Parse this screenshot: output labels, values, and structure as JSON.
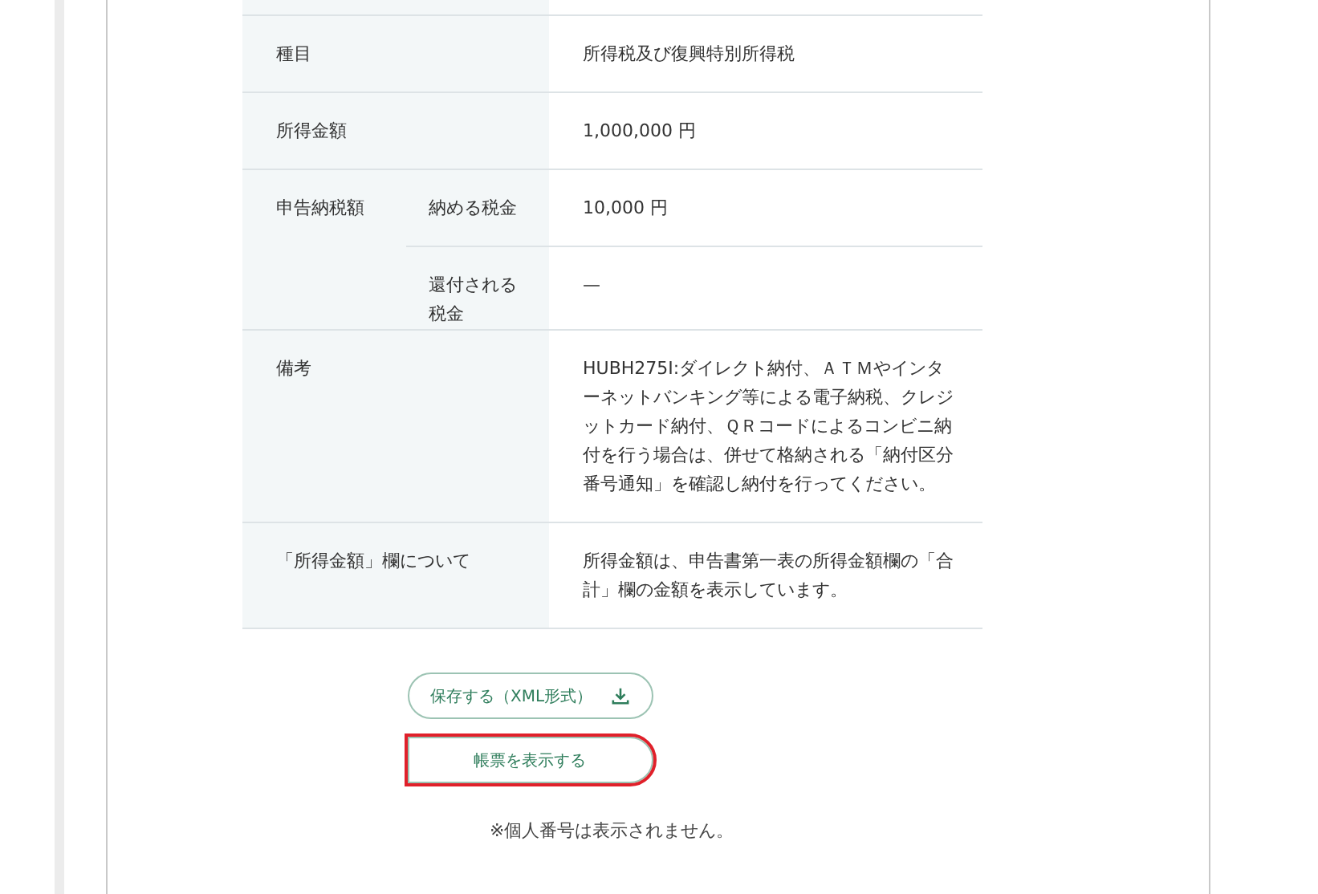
{
  "table": {
    "rows": [
      {
        "label": "種目",
        "value": "所得税及び復興特別所得税"
      },
      {
        "label": "所得金額",
        "value": "1,000,000 円"
      },
      {
        "label": "申告納税額",
        "items": [
          {
            "label": "納める税金",
            "value": "10,000 円"
          },
          {
            "label": "還付される税金",
            "value": "—"
          }
        ]
      },
      {
        "label": "備考",
        "value": "HUBH275I:ダイレクト納付、ＡＴＭやインターネットバンキング等による電子納税、クレジットカード納付、ＱＲコードによるコンビニ納付を行う場合は、併せて格納される「納付区分番号通知」を確認し納付を行ってください。"
      },
      {
        "label": "「所得金額」欄について",
        "value": "所得金額は、申告書第一表の所得金額欄の「合計」欄の金額を表示しています。"
      }
    ]
  },
  "buttons": [
    {
      "label": "保存する（XML形式）",
      "kind": "download",
      "highlighted": false
    },
    {
      "label": "帳票を表示する",
      "kind": "plain",
      "highlighted": true
    }
  ],
  "note": "※個人番号は表示されません。"
}
